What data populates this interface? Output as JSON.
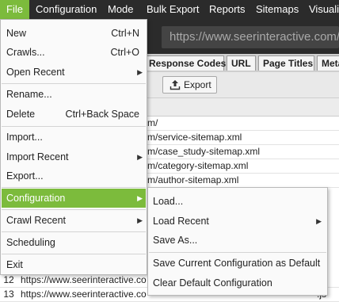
{
  "menubar": {
    "items": [
      "File",
      "Configuration",
      "Mode",
      "Bulk Export",
      "Reports",
      "Sitemaps",
      "Visualis"
    ]
  },
  "url_field": {
    "value": "https://www.seerinteractive.com/"
  },
  "tabs": [
    "Response Codes",
    "URL",
    "Page Titles",
    "Meta"
  ],
  "toolbar": {
    "export_label": "Export",
    "export_icon": "export-icon"
  },
  "table": {
    "rows": [
      {
        "num": "",
        "tail": "m/"
      },
      {
        "num": "",
        "tail": "m/service-sitemap.xml"
      },
      {
        "num": "",
        "tail": "m/case_study-sitemap.xml"
      },
      {
        "num": "",
        "tail": "m/category-sitemap.xml"
      },
      {
        "num": "",
        "tail": "m/author-sitemap.xml"
      },
      {
        "num": "12",
        "url": "https://www.seerinteractive.co",
        "tail": "ks"
      },
      {
        "num": "13",
        "url": "https://www.seerinteractive.co",
        "tail": ".js"
      }
    ]
  },
  "file_menu": {
    "items": [
      {
        "label": "New",
        "shortcut": "Ctrl+N"
      },
      {
        "label": "Crawls...",
        "shortcut": "Ctrl+O"
      },
      {
        "label": "Open Recent",
        "submenu": true
      },
      {
        "label": "Rename..."
      },
      {
        "label": "Delete",
        "shortcut": "Ctrl+Back Space"
      },
      {
        "label": "Import..."
      },
      {
        "label": "Import Recent",
        "submenu": true
      },
      {
        "label": "Export..."
      },
      {
        "label": "Configuration",
        "submenu": true,
        "highlighted": true
      },
      {
        "label": "Crawl Recent",
        "submenu": true
      },
      {
        "label": "Scheduling"
      },
      {
        "label": "Exit"
      }
    ]
  },
  "config_submenu": {
    "items": [
      {
        "label": "Load..."
      },
      {
        "label": "Load Recent",
        "submenu": true
      },
      {
        "label": "Save As..."
      },
      {
        "label": "Save Current Configuration as Default"
      },
      {
        "label": "Clear Default Configuration"
      }
    ]
  },
  "colors": {
    "accent": "#7cbb3c",
    "menubar": "#2b2b2b"
  }
}
